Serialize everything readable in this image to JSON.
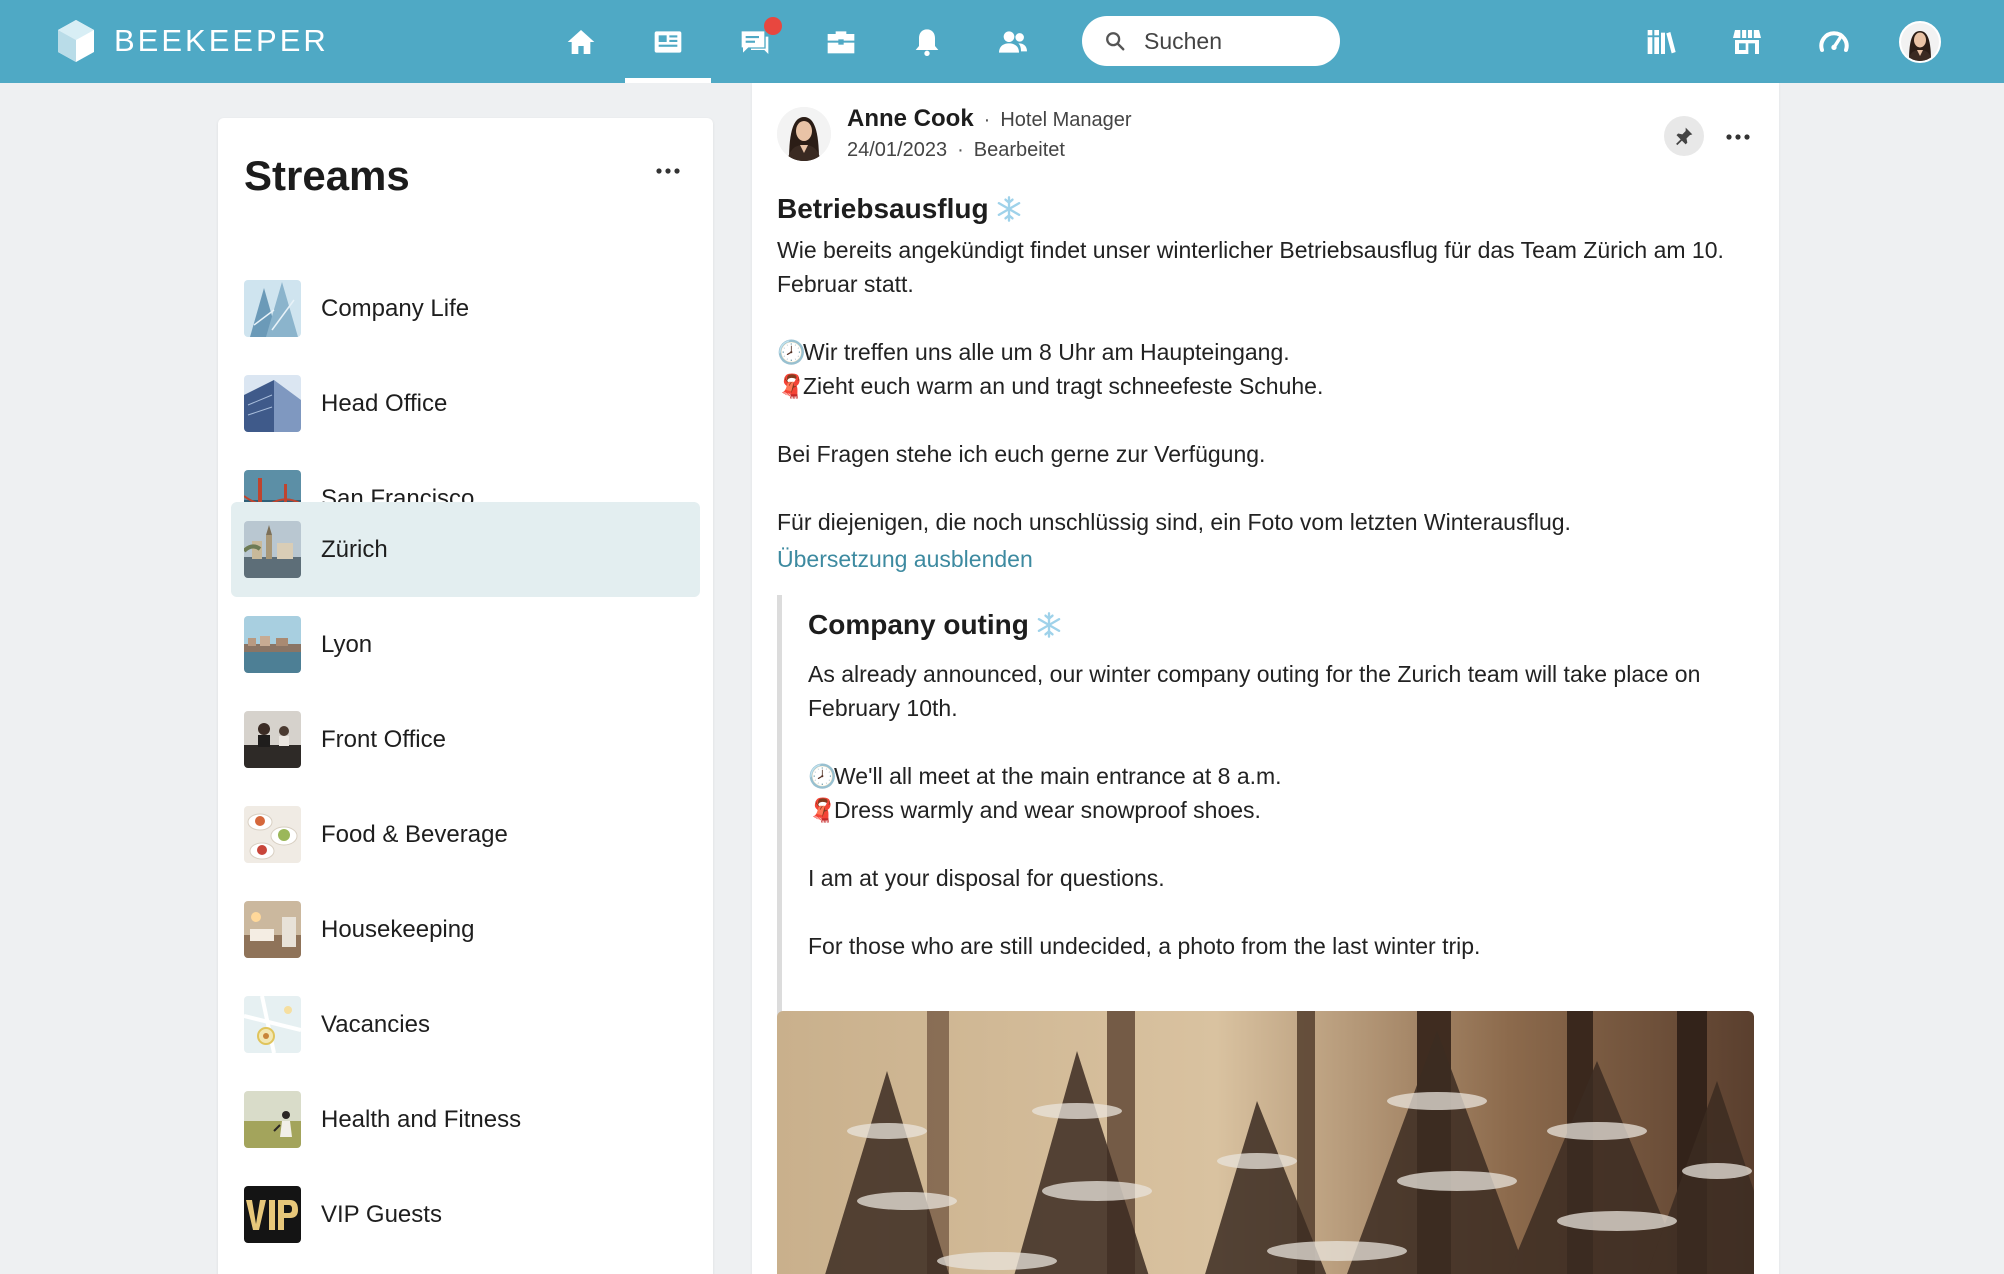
{
  "header": {
    "brand": "BEEKEEPER",
    "search_placeholder": "Suchen",
    "nav": [
      "home-icon",
      "news-feed-icon",
      "chat-icon",
      "apps-icon",
      "bell-icon",
      "people-icon"
    ],
    "right": [
      "library-icon",
      "store-icon",
      "dashboard-icon",
      "user-avatar"
    ],
    "colors": {
      "bar": "#4fa9c5",
      "notification": "#e8473f"
    }
  },
  "streams": {
    "title": "Streams",
    "items": [
      {
        "label": "Company Life"
      },
      {
        "label": "Head Office"
      },
      {
        "label": "San Francisco"
      },
      {
        "label": "Zürich",
        "selected": true
      },
      {
        "label": "Lyon"
      },
      {
        "label": "Front Office"
      },
      {
        "label": "Food & Beverage"
      },
      {
        "label": "Housekeeping"
      },
      {
        "label": "Vacancies"
      },
      {
        "label": "Health and Fitness"
      },
      {
        "label": "VIP Guests"
      }
    ]
  },
  "post": {
    "author": "Anne Cook",
    "role": "Hotel Manager",
    "date": "24/01/2023",
    "edited": "Bearbeitet",
    "title": "Betriebsausflug",
    "body": {
      "p1": "Wie bereits angekündigt findet unser winterlicher Betriebsausflug für das Team Zürich am 10. Februar statt.",
      "p2": "Wir treffen uns alle um 8 Uhr am Haupteingang.",
      "p3": "Zieht euch warm an und tragt schneefeste Schuhe.",
      "p4": "Bei Fragen stehe ich euch gerne zur Verfügung.",
      "p5": "Für diejenigen, die noch unschlüssig sind, ein Foto vom letzten Winterausflug."
    },
    "translate_link": "Übersetzung ausblenden",
    "translation": {
      "title": "Company outing",
      "p1": "As already announced, our winter company outing for the Zurich team will take place on February 10th.",
      "p2": "We'll all meet at the main entrance at 8 a.m.",
      "p3": "Dress warmly and wear snowproof shoes.",
      "p4": "I am at your disposal for questions.",
      "p5": "For those who are still undecided, a photo from the last winter trip."
    },
    "emoji": {
      "clock": "🕗",
      "scarf": "🧣"
    },
    "colors": {
      "link": "#3d8aa0"
    }
  }
}
